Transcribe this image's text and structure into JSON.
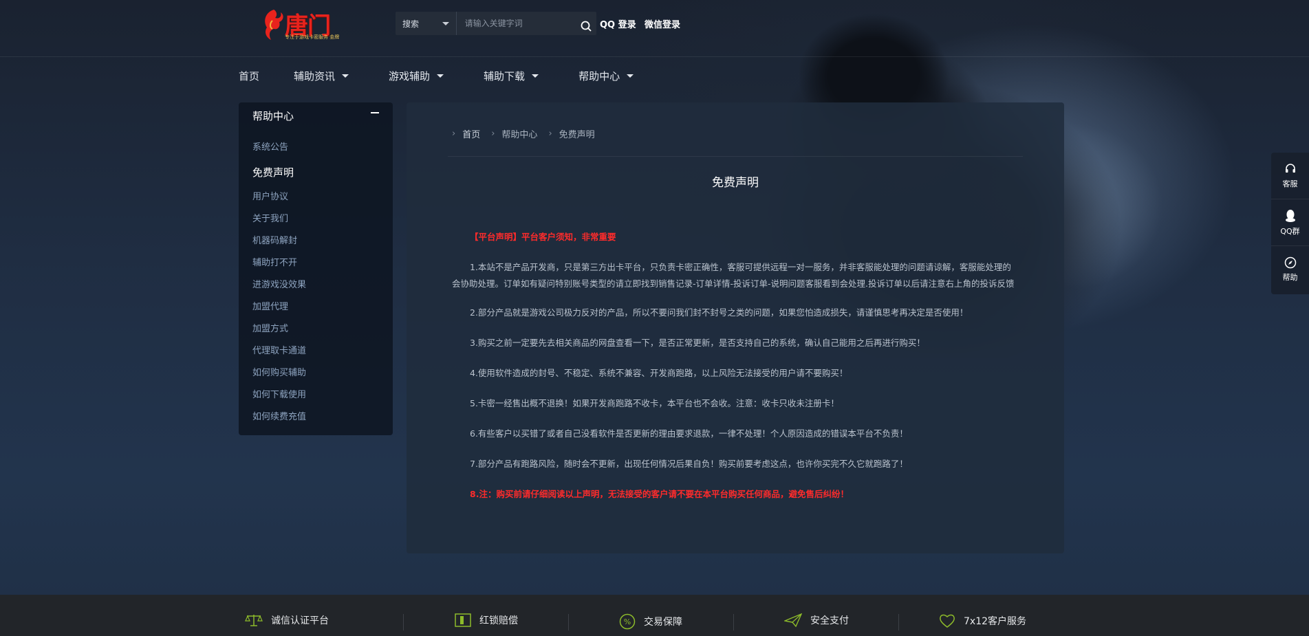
{
  "header": {
    "logo_text": "唐门",
    "logo_tagline": "专注于游戏卡密服务 金牌",
    "search": {
      "select_label": "搜索",
      "placeholder": "请输入关键字词"
    },
    "login_qq": "QQ 登录",
    "login_wechat": "微信登录"
  },
  "nav": {
    "home": "首页",
    "items": [
      "辅助资讯",
      "游戏辅助",
      "辅助下载",
      "帮助中心"
    ]
  },
  "sidebar": {
    "title": "帮助中心",
    "items": [
      {
        "label": "系统公告"
      },
      {
        "label": "免费声明",
        "active": true
      },
      {
        "label": "用户协议"
      },
      {
        "label": "关于我们"
      },
      {
        "label": "机器码解封"
      },
      {
        "label": "辅助打不开"
      },
      {
        "label": "进游戏没效果"
      },
      {
        "label": "加盟代理"
      },
      {
        "label": "加盟方式"
      },
      {
        "label": "代理取卡通道"
      },
      {
        "label": "如何购买辅助"
      },
      {
        "label": "如何下载使用"
      },
      {
        "label": "如何续费充值"
      }
    ]
  },
  "breadcrumb": [
    "首页",
    "帮助中心",
    "免费声明"
  ],
  "article": {
    "title": "免费声明",
    "paragraphs": [
      {
        "text": "【平台声明】平台客户须知，非常重要",
        "red": true
      },
      {
        "text": "1.本站不是产品开发商，只是第三方出卡平台，只负责卡密正确性，客服可提供远程一对一服务，并非客服能处理的问题请谅解，客服能处理的会协助处理。订单如有疑问特别账号类型的请立即找到销售记录-订单详情-投诉订单-说明问题客服看到会处理.投诉订单以后请注意右上角的投诉反馈",
        "red": false
      },
      {
        "text": "2.部分产品就是游戏公司极力反对的产品，所以不要问我们封不封号之类的问题，如果您怕造成损失，请谨慎思考再决定是否使用！",
        "red": false
      },
      {
        "text": "3.购买之前一定要先去相关商品的网盘查看一下，是否正常更新，是否支持自己的系统，确认自己能用之后再进行购买！",
        "red": false
      },
      {
        "text": "4.使用软件造成的封号、不稳定、系统不兼容、开发商跑路，以上风险无法接受的用户请不要购买！",
        "red": false
      },
      {
        "text": "5.卡密一经售出概不退换！如果开发商跑路不收卡，本平台也不会收。注意：收卡只收未注册卡！",
        "red": false
      },
      {
        "text": "6.有些客户以买错了或者自己没看软件是否更新的理由要求退款，一律不处理！个人原因造成的错误本平台不负责！",
        "red": false
      },
      {
        "text": "7.部分产品有跑路风险，随时会不更新，出现任何情况后果自负！购买前要考虑这点，也许你买完不久它就跑路了！",
        "red": false
      },
      {
        "text": "8.注：购买前请仔细阅读以上声明，无法接受的客户请不要在本平台购买任何商品，避免售后纠纷！",
        "red": true
      }
    ]
  },
  "float_toolbar": [
    {
      "label": "客服",
      "icon": "headset-icon"
    },
    {
      "label": "QQ群",
      "icon": "qq-penguin-icon"
    },
    {
      "label": "帮助",
      "icon": "compass-icon"
    }
  ],
  "footer": {
    "features": [
      {
        "label": "诚信认证平台",
        "icon": "balance-scale-icon"
      },
      {
        "label": "红锁赔偿",
        "icon": "lock-box-icon"
      },
      {
        "label": "交易保障",
        "icon": "percent-circle-icon"
      },
      {
        "label": "安全支付",
        "icon": "paper-plane-icon"
      },
      {
        "label": "7x12客户服务",
        "icon": "heart-icon"
      }
    ],
    "icon_color": "#8dbb2a"
  }
}
